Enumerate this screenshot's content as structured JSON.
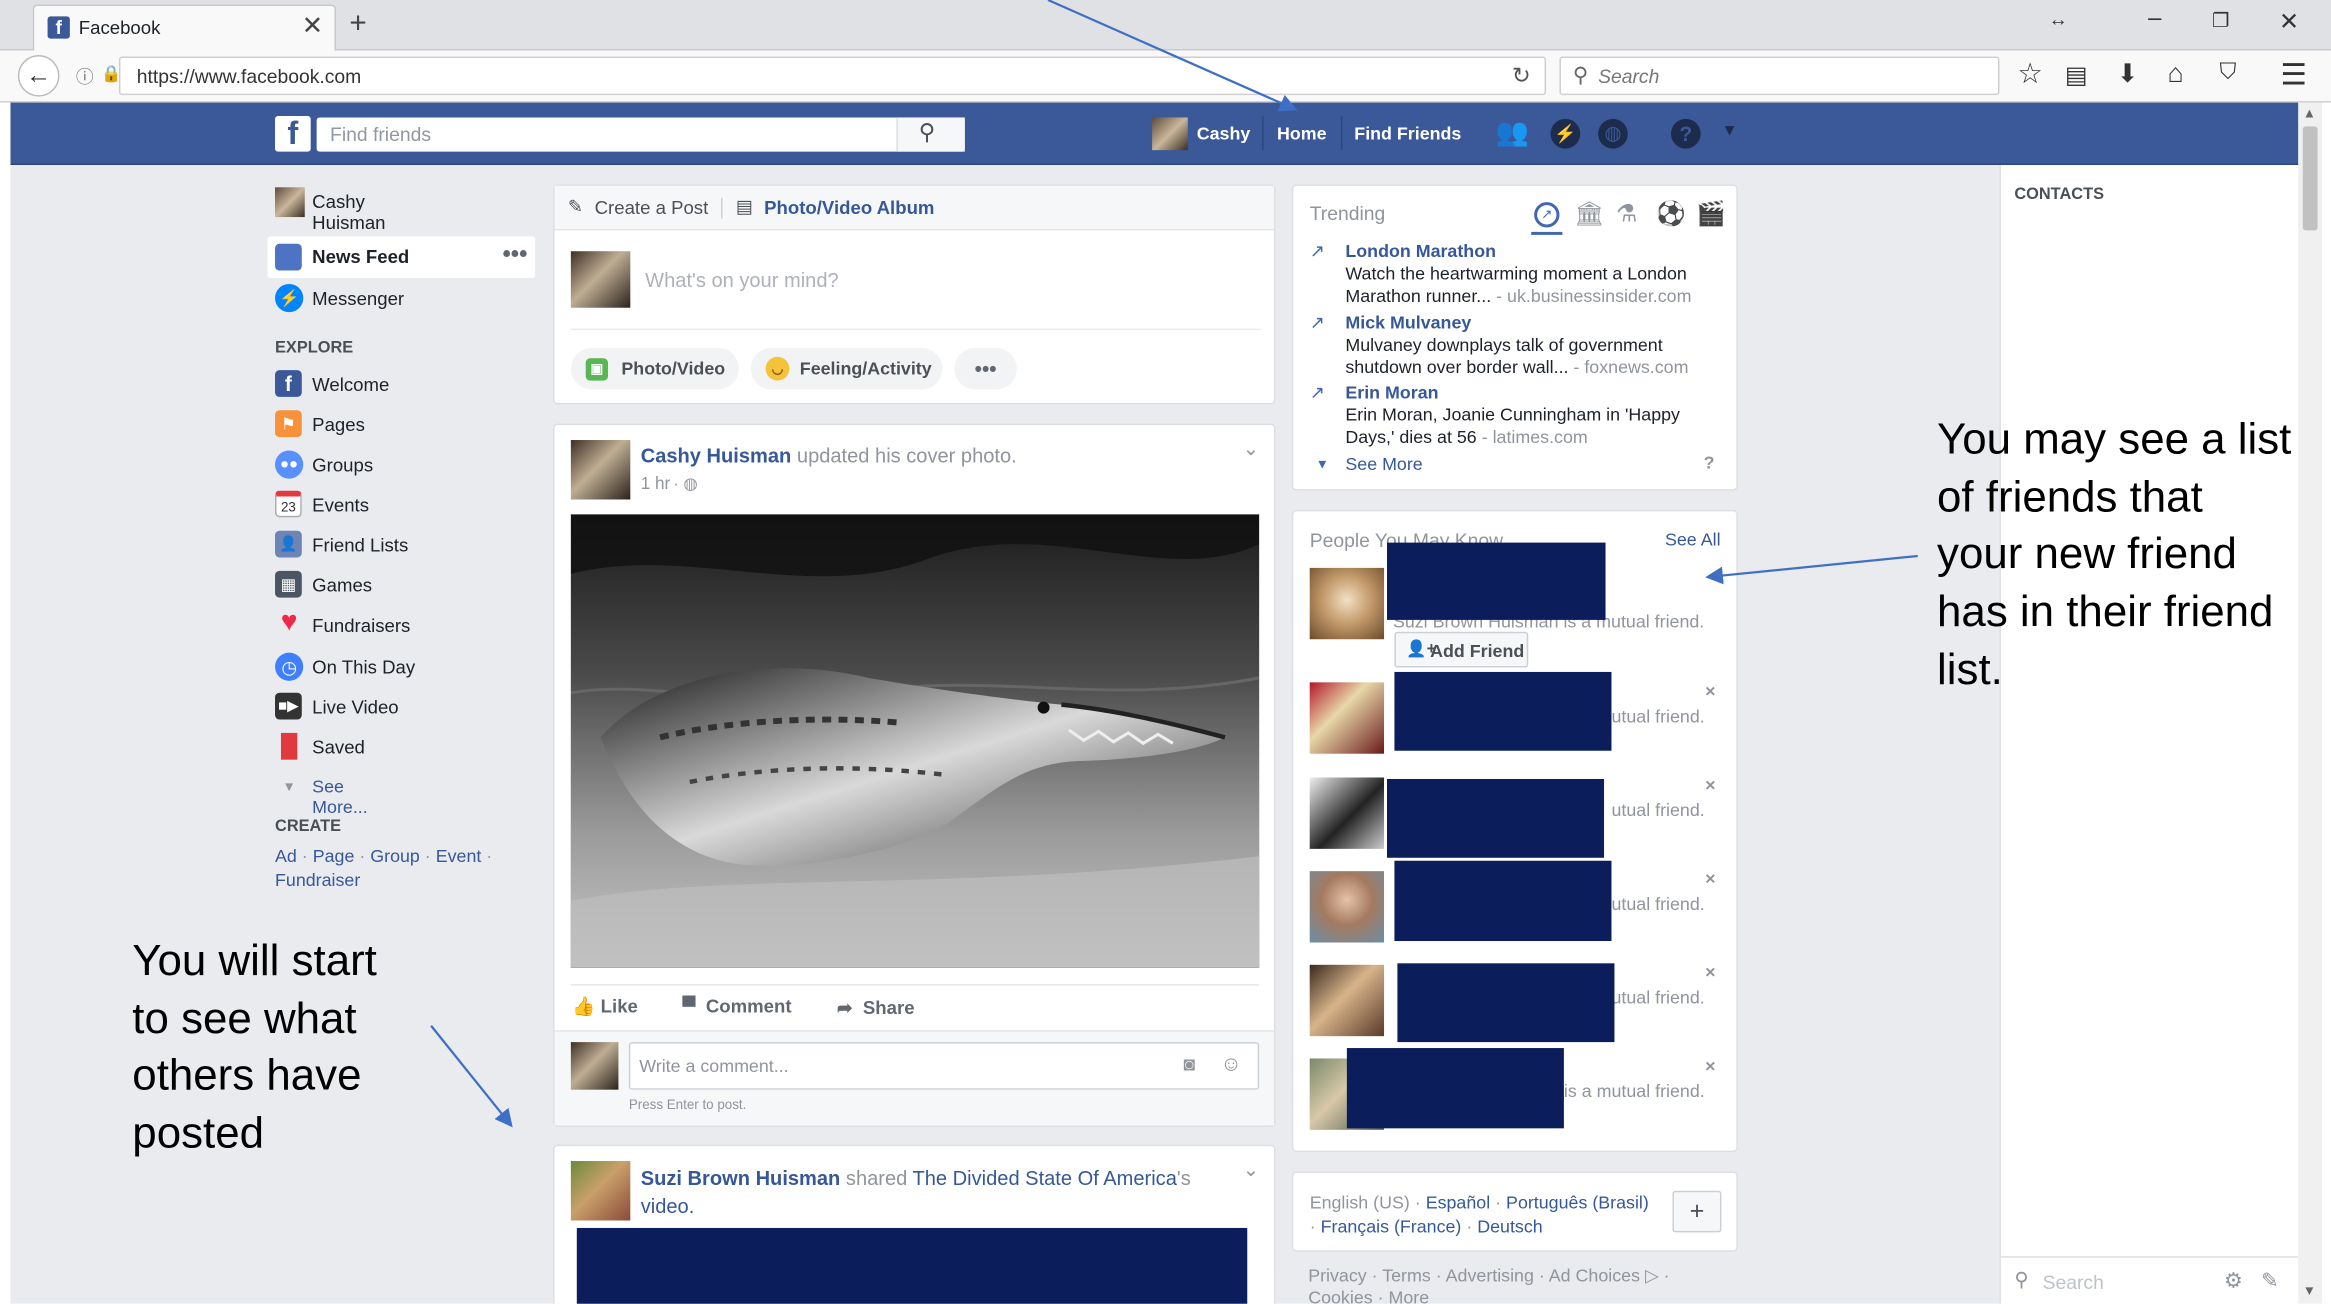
{
  "browser": {
    "tab_title": "Facebook",
    "url": "https://www.facebook.com",
    "search_placeholder": "Search"
  },
  "header": {
    "search_placeholder": "Find friends",
    "user_name": "Cashy",
    "home": "Home",
    "find_friends": "Find Friends"
  },
  "left_nav": {
    "profile_name": "Cashy Huisman",
    "top_items": [
      {
        "label": "News Feed",
        "icon": "news-feed-icon"
      },
      {
        "label": "Messenger",
        "icon": "messenger-icon"
      }
    ],
    "explore_heading": "EXPLORE",
    "explore_items": [
      {
        "label": "Welcome",
        "icon": "facebook-icon"
      },
      {
        "label": "Pages",
        "icon": "flag-icon"
      },
      {
        "label": "Groups",
        "icon": "groups-icon"
      },
      {
        "label": "Events",
        "icon": "calendar-icon",
        "badge": "23"
      },
      {
        "label": "Friend Lists",
        "icon": "friend-list-icon"
      },
      {
        "label": "Games",
        "icon": "games-icon"
      },
      {
        "label": "Fundraisers",
        "icon": "heart-icon"
      },
      {
        "label": "On This Day",
        "icon": "clock-icon"
      },
      {
        "label": "Live Video",
        "icon": "video-camera-icon"
      },
      {
        "label": "Saved",
        "icon": "bookmark-icon"
      }
    ],
    "see_more": "See More...",
    "create_heading": "CREATE",
    "create_links": [
      "Ad",
      "Page",
      "Group",
      "Event",
      "Fundraiser"
    ]
  },
  "composer": {
    "create_post": "Create a Post",
    "photo_album": "Photo/Video Album",
    "placeholder": "What's on your mind?",
    "photo_video": "Photo/Video",
    "feeling": "Feeling/Activity"
  },
  "post1": {
    "author": "Cashy Huisman",
    "action": "updated his cover photo.",
    "time": "1 hr",
    "like": "Like",
    "comment": "Comment",
    "share": "Share",
    "comment_placeholder": "Write a comment...",
    "press_enter": "Press Enter to post."
  },
  "post2": {
    "author": "Suzi Brown Huisman",
    "action": "shared",
    "page": "The Divided State Of America",
    "suffix": "'s",
    "suffix2": "video."
  },
  "trending": {
    "heading": "Trending",
    "items": [
      {
        "title": "London Marathon",
        "line1": "Watch the heartwarming moment a London",
        "line2": "Marathon runner...",
        "source": "uk.businessinsider.com"
      },
      {
        "title": "Mick Mulvaney",
        "line1": "Mulvaney downplays talk of government",
        "line2": "shutdown over border wall...",
        "source": "foxnews.com"
      },
      {
        "title": "Erin Moran",
        "line1": "Erin Moran, Joanie Cunningham in 'Happy",
        "line2": "Days,' dies at 56",
        "source": "latimes.com"
      }
    ],
    "see_more": "See More",
    "help": "?"
  },
  "pymk": {
    "heading": "People You May Know",
    "see_all": "See All",
    "first_mutual": "Suzi Brown Huisman is a mutual friend.",
    "add_friend": "Add Friend",
    "partial_mutual": "utual friend.",
    "last_mutual": "is a mutual friend.",
    "close": "×"
  },
  "footer": {
    "languages": [
      "English (US)",
      "Español",
      "Português (Brasil)",
      "Français (France)",
      "Deutsch"
    ],
    "plus": "+",
    "links": "Privacy · Terms · Advertising · Ad Choices",
    "links2": "Cookies · More"
  },
  "contacts": {
    "heading": "CONTACTS",
    "search_placeholder": "Search"
  },
  "annotations": {
    "left": [
      "You will start",
      "to see what",
      "others have",
      "posted"
    ],
    "right": [
      "You may see a list",
      "of friends that",
      "your new friend",
      "has in their friend",
      "list."
    ]
  },
  "colors": {
    "facebook_blue": "#3b5998",
    "link": "#365899",
    "redaction": "#0b1e5b",
    "page_bg": "#e9ebee"
  }
}
